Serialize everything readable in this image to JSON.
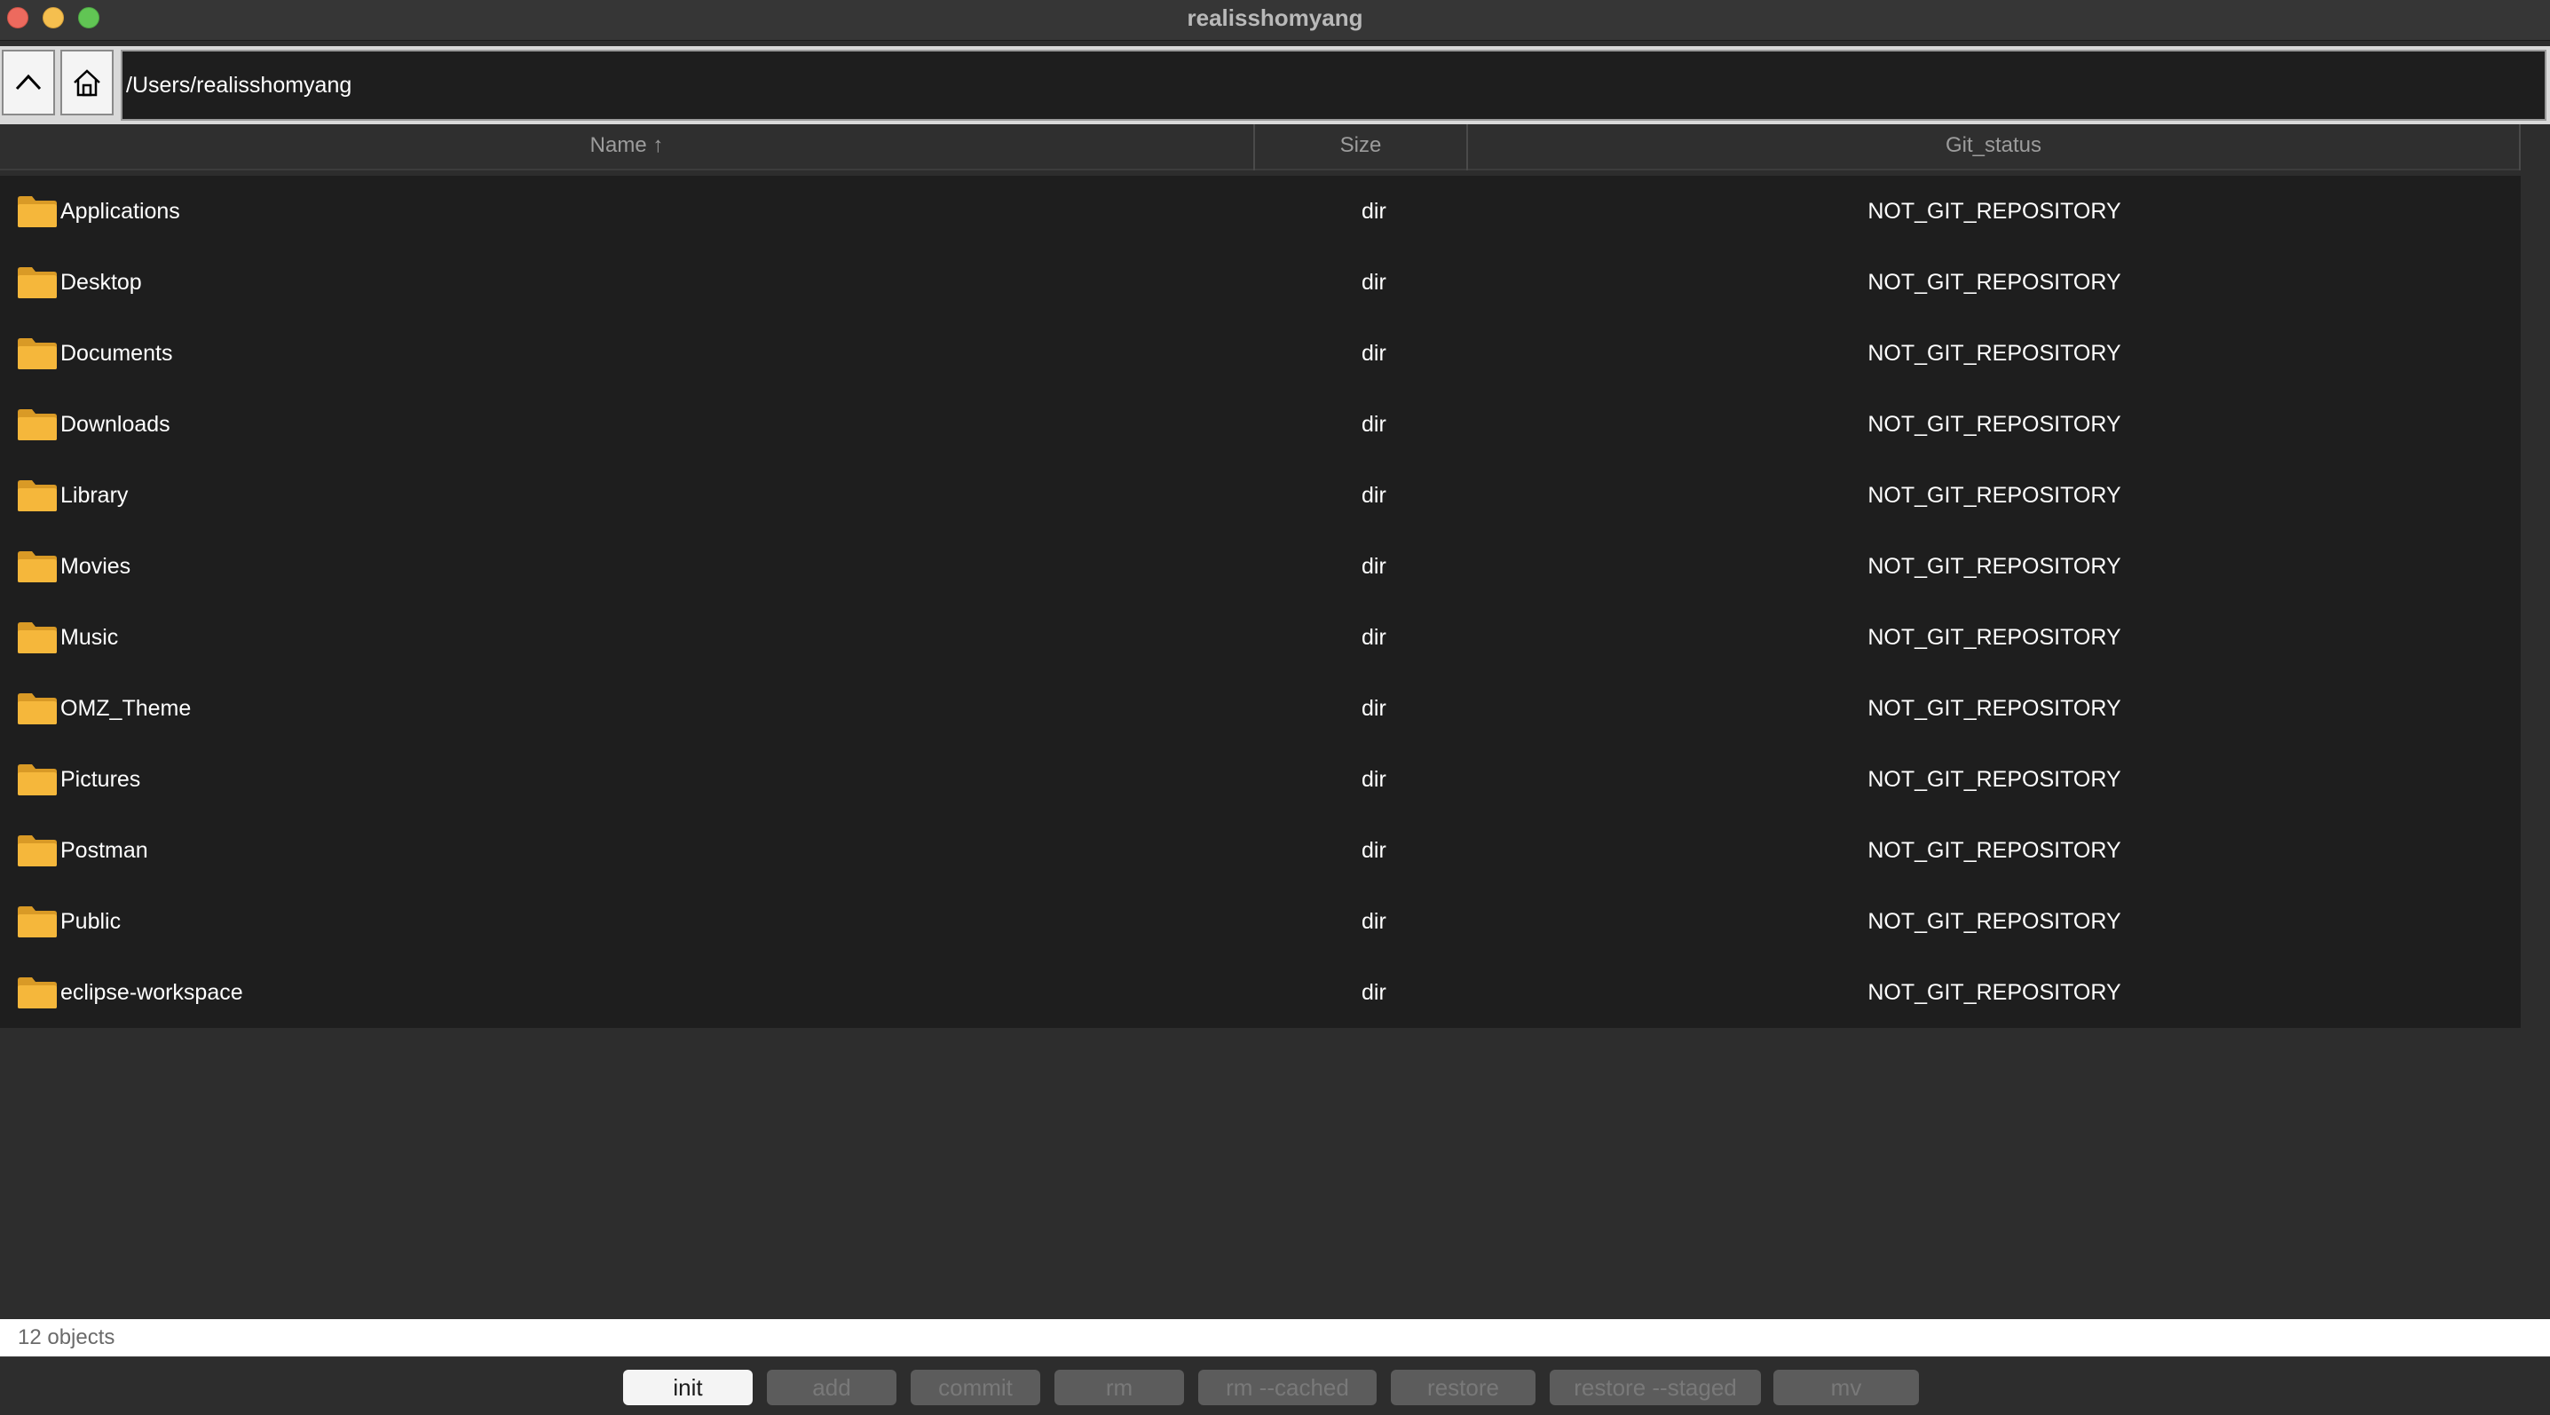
{
  "window": {
    "title": "realisshomyang"
  },
  "toolbar": {
    "path": "/Users/realisshomyang"
  },
  "table": {
    "columns": {
      "name": "Name ↑",
      "size": "Size",
      "git": "Git_status"
    },
    "rows": [
      {
        "name": "Applications",
        "size": "dir",
        "git": "NOT_GIT_REPOSITORY"
      },
      {
        "name": "Desktop",
        "size": "dir",
        "git": "NOT_GIT_REPOSITORY"
      },
      {
        "name": "Documents",
        "size": "dir",
        "git": "NOT_GIT_REPOSITORY"
      },
      {
        "name": "Downloads",
        "size": "dir",
        "git": "NOT_GIT_REPOSITORY"
      },
      {
        "name": "Library",
        "size": "dir",
        "git": "NOT_GIT_REPOSITORY"
      },
      {
        "name": "Movies",
        "size": "dir",
        "git": "NOT_GIT_REPOSITORY"
      },
      {
        "name": "Music",
        "size": "dir",
        "git": "NOT_GIT_REPOSITORY"
      },
      {
        "name": "OMZ_Theme",
        "size": "dir",
        "git": "NOT_GIT_REPOSITORY"
      },
      {
        "name": "Pictures",
        "size": "dir",
        "git": "NOT_GIT_REPOSITORY"
      },
      {
        "name": "Postman",
        "size": "dir",
        "git": "NOT_GIT_REPOSITORY"
      },
      {
        "name": "Public",
        "size": "dir",
        "git": "NOT_GIT_REPOSITORY"
      },
      {
        "name": "eclipse-workspace",
        "size": "dir",
        "git": "NOT_GIT_REPOSITORY"
      }
    ]
  },
  "status": {
    "text": "12 objects"
  },
  "buttons": [
    {
      "label": "init",
      "enabled": true
    },
    {
      "label": "add",
      "enabled": false
    },
    {
      "label": "commit",
      "enabled": false
    },
    {
      "label": "rm",
      "enabled": false
    },
    {
      "label": "rm --cached",
      "enabled": false
    },
    {
      "label": "restore",
      "enabled": false
    },
    {
      "label": "restore --staged",
      "enabled": false
    },
    {
      "label": "mv",
      "enabled": false
    }
  ],
  "icons": {
    "up": "chevron-up-icon",
    "home": "home-icon",
    "folder": "folder-icon"
  },
  "colors": {
    "folder": "#f5b73b",
    "accent_close": "#ed6a5e",
    "accent_min": "#f5bf4f",
    "accent_max": "#61c554"
  }
}
